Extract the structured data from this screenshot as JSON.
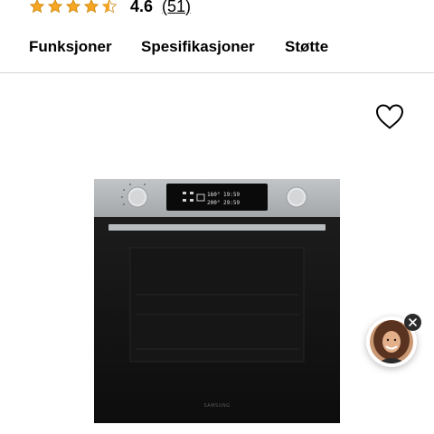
{
  "rating": {
    "value": "4.6",
    "count": "(51)",
    "stars_filled": 4.5,
    "stars_total": 5,
    "star_color": "#f6a623"
  },
  "tabs": [
    {
      "label": "Funksjoner"
    },
    {
      "label": "Spesifikasjoner"
    },
    {
      "label": "Støtte"
    }
  ],
  "icons": {
    "wishlist": "heart-outline-icon",
    "chat_close": "close-icon",
    "chat_avatar": "support-agent-avatar"
  },
  "product": {
    "image": "built-in-oven",
    "display_text_1": "160° 19:59",
    "display_text_2": "200° 29:59",
    "brand_mark": "SAMSUNG"
  },
  "colors": {
    "divider": "#d6d6d6",
    "oven_panel": "#aeb1b4",
    "oven_door": "#141414"
  }
}
